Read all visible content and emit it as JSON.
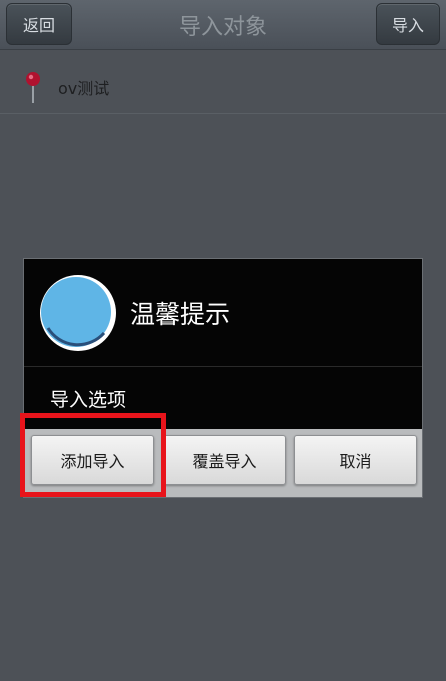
{
  "navbar": {
    "back_label": "返回",
    "title": "导入对象",
    "import_label": "导入"
  },
  "list": {
    "items": [
      {
        "label": "ov测试",
        "icon": "map-pin-icon"
      }
    ]
  },
  "dialog": {
    "title": "温馨提示",
    "icon": "info-circle-icon",
    "message": "导入选项",
    "buttons": {
      "add": "添加导入",
      "overwrite": "覆盖导入",
      "cancel": "取消"
    }
  },
  "colors": {
    "icon_blue": "#5fb5e6",
    "pin_red": "#b0122f",
    "highlight_red": "#e8141b"
  }
}
